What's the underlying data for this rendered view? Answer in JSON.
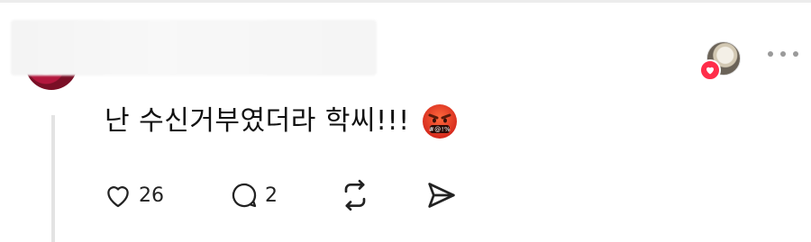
{
  "comment": {
    "text": "난 수신거부였더라 학씨!!!",
    "emoji_icon": "face-with-symbols-on-mouth-icon"
  },
  "actions": {
    "likes": "26",
    "replies": "2",
    "repost_icon": "repost-icon",
    "share_icon": "send-icon"
  },
  "reaction": {
    "badge_icon": "heart-icon",
    "badge_color": "#ff2d4a"
  },
  "menu": {
    "icon": "more-horizontal-icon"
  }
}
